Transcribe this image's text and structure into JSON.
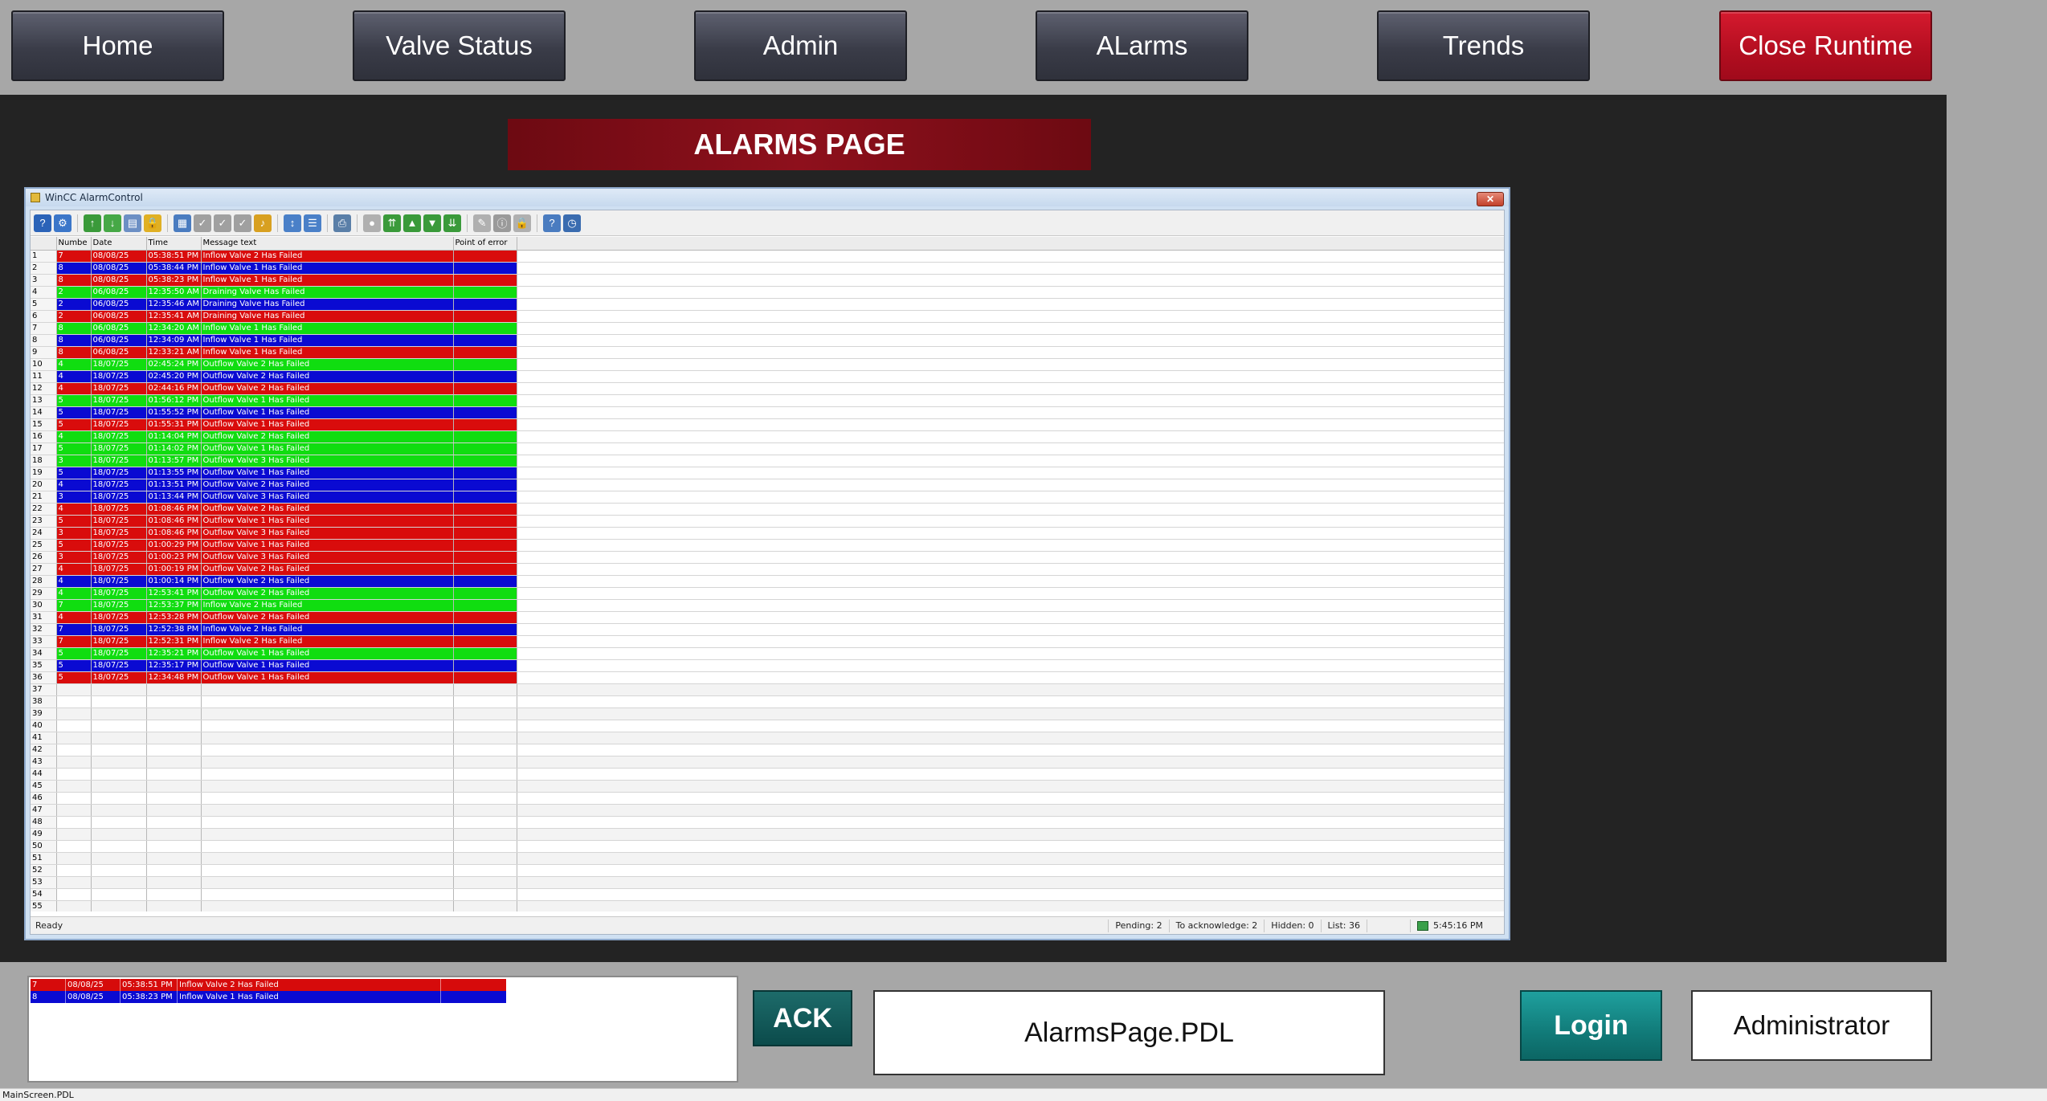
{
  "nav": {
    "home": "Home",
    "valve_status": "Valve Status",
    "admin": "Admin",
    "alarms": "ALarms",
    "trends": "Trends",
    "close_runtime": "Close Runtime"
  },
  "page_title": "ALARMS PAGE",
  "alarm_control": {
    "window_title": "WinCC AlarmControl",
    "close_glyph": "✕",
    "columns": [
      "Numbe",
      "Date",
      "Time",
      "Message text",
      "Point of error"
    ],
    "rows": [
      {
        "no": "1",
        "num": "7",
        "date": "08/08/25",
        "time": "05:38:51 PM",
        "msg": "Inflow Valve 2 Has Failed",
        "color": "red"
      },
      {
        "no": "2",
        "num": "8",
        "date": "08/08/25",
        "time": "05:38:44 PM",
        "msg": "Inflow Valve 1 Has Failed",
        "color": "blue"
      },
      {
        "no": "3",
        "num": "8",
        "date": "08/08/25",
        "time": "05:38:23 PM",
        "msg": "Inflow Valve 1 Has Failed",
        "color": "red"
      },
      {
        "no": "4",
        "num": "2",
        "date": "06/08/25",
        "time": "12:35:50 AM",
        "msg": "Draining Valve Has Failed",
        "color": "green"
      },
      {
        "no": "5",
        "num": "2",
        "date": "06/08/25",
        "time": "12:35:46 AM",
        "msg": "Draining Valve Has Failed",
        "color": "blue"
      },
      {
        "no": "6",
        "num": "2",
        "date": "06/08/25",
        "time": "12:35:41 AM",
        "msg": "Draining Valve Has Failed",
        "color": "red"
      },
      {
        "no": "7",
        "num": "8",
        "date": "06/08/25",
        "time": "12:34:20 AM",
        "msg": "Inflow Valve 1 Has Failed",
        "color": "green"
      },
      {
        "no": "8",
        "num": "8",
        "date": "06/08/25",
        "time": "12:34:09 AM",
        "msg": "Inflow Valve 1 Has Failed",
        "color": "blue"
      },
      {
        "no": "9",
        "num": "8",
        "date": "06/08/25",
        "time": "12:33:21 AM",
        "msg": "Inflow Valve 1 Has Failed",
        "color": "red"
      },
      {
        "no": "10",
        "num": "4",
        "date": "18/07/25",
        "time": "02:45:24 PM",
        "msg": "Outflow Valve 2 Has Failed",
        "color": "green"
      },
      {
        "no": "11",
        "num": "4",
        "date": "18/07/25",
        "time": "02:45:20 PM",
        "msg": "Outflow Valve 2 Has Failed",
        "color": "blue"
      },
      {
        "no": "12",
        "num": "4",
        "date": "18/07/25",
        "time": "02:44:16 PM",
        "msg": "Outflow Valve 2 Has Failed",
        "color": "red"
      },
      {
        "no": "13",
        "num": "5",
        "date": "18/07/25",
        "time": "01:56:12 PM",
        "msg": "Outflow Valve 1 Has Failed",
        "color": "green"
      },
      {
        "no": "14",
        "num": "5",
        "date": "18/07/25",
        "time": "01:55:52 PM",
        "msg": "Outflow Valve 1 Has Failed",
        "color": "blue"
      },
      {
        "no": "15",
        "num": "5",
        "date": "18/07/25",
        "time": "01:55:31 PM",
        "msg": "Outflow Valve 1 Has Failed",
        "color": "red"
      },
      {
        "no": "16",
        "num": "4",
        "date": "18/07/25",
        "time": "01:14:04 PM",
        "msg": "Outflow Valve 2 Has Failed",
        "color": "green"
      },
      {
        "no": "17",
        "num": "5",
        "date": "18/07/25",
        "time": "01:14:02 PM",
        "msg": "Outflow Valve 1 Has Failed",
        "color": "green"
      },
      {
        "no": "18",
        "num": "3",
        "date": "18/07/25",
        "time": "01:13:57 PM",
        "msg": "Outflow Valve 3 Has Failed",
        "color": "green"
      },
      {
        "no": "19",
        "num": "5",
        "date": "18/07/25",
        "time": "01:13:55 PM",
        "msg": "Outflow Valve 1 Has Failed",
        "color": "blue"
      },
      {
        "no": "20",
        "num": "4",
        "date": "18/07/25",
        "time": "01:13:51 PM",
        "msg": "Outflow Valve 2 Has Failed",
        "color": "blue"
      },
      {
        "no": "21",
        "num": "3",
        "date": "18/07/25",
        "time": "01:13:44 PM",
        "msg": "Outflow Valve 3 Has Failed",
        "color": "blue"
      },
      {
        "no": "22",
        "num": "4",
        "date": "18/07/25",
        "time": "01:08:46 PM",
        "msg": "Outflow Valve 2 Has Failed",
        "color": "red"
      },
      {
        "no": "23",
        "num": "5",
        "date": "18/07/25",
        "time": "01:08:46 PM",
        "msg": "Outflow Valve 1 Has Failed",
        "color": "red"
      },
      {
        "no": "24",
        "num": "3",
        "date": "18/07/25",
        "time": "01:08:46 PM",
        "msg": "Outflow Valve 3 Has Failed",
        "color": "red"
      },
      {
        "no": "25",
        "num": "5",
        "date": "18/07/25",
        "time": "01:00:29 PM",
        "msg": "Outflow Valve 1 Has Failed",
        "color": "red"
      },
      {
        "no": "26",
        "num": "3",
        "date": "18/07/25",
        "time": "01:00:23 PM",
        "msg": "Outflow Valve 3 Has Failed",
        "color": "red"
      },
      {
        "no": "27",
        "num": "4",
        "date": "18/07/25",
        "time": "01:00:19 PM",
        "msg": "Outflow Valve 2 Has Failed",
        "color": "red"
      },
      {
        "no": "28",
        "num": "4",
        "date": "18/07/25",
        "time": "01:00:14 PM",
        "msg": "Outflow Valve 2 Has Failed",
        "color": "blue"
      },
      {
        "no": "29",
        "num": "4",
        "date": "18/07/25",
        "time": "12:53:41 PM",
        "msg": "Outflow Valve 2 Has Failed",
        "color": "green"
      },
      {
        "no": "30",
        "num": "7",
        "date": "18/07/25",
        "time": "12:53:37 PM",
        "msg": "Inflow Valve 2 Has Failed",
        "color": "green"
      },
      {
        "no": "31",
        "num": "4",
        "date": "18/07/25",
        "time": "12:53:28 PM",
        "msg": "Outflow Valve 2 Has Failed",
        "color": "red"
      },
      {
        "no": "32",
        "num": "7",
        "date": "18/07/25",
        "time": "12:52:38 PM",
        "msg": "Inflow Valve 2 Has Failed",
        "color": "blue"
      },
      {
        "no": "33",
        "num": "7",
        "date": "18/07/25",
        "time": "12:52:31 PM",
        "msg": "Inflow Valve 2 Has Failed",
        "color": "red"
      },
      {
        "no": "34",
        "num": "5",
        "date": "18/07/25",
        "time": "12:35:21 PM",
        "msg": "Outflow Valve 1 Has Failed",
        "color": "green"
      },
      {
        "no": "35",
        "num": "5",
        "date": "18/07/25",
        "time": "12:35:17 PM",
        "msg": "Outflow Valve 1 Has Failed",
        "color": "blue"
      },
      {
        "no": "36",
        "num": "5",
        "date": "18/07/25",
        "time": "12:34:48 PM",
        "msg": "Outflow Valve 1 Has Failed",
        "color": "red"
      }
    ],
    "empty_row_numbers": [
      "37",
      "38",
      "39",
      "40",
      "41",
      "42",
      "43",
      "44",
      "45",
      "46",
      "47",
      "48",
      "49",
      "50",
      "51",
      "52",
      "53",
      "54",
      "55"
    ],
    "status": {
      "ready": "Ready",
      "pending": "Pending: 2",
      "to_acknowledge": "To acknowledge: 2",
      "hidden": "Hidden: 0",
      "list": "List: 36",
      "clock": "5:45:16 PM"
    },
    "toolbar_icons": [
      "help-icon",
      "config-icon",
      "first-page-icon",
      "prev-page-icon",
      "report-icon",
      "lock-icon",
      "chart-icon",
      "ack-single-icon",
      "ack-group-icon",
      "ack-emergency-icon",
      "hornsignal-icon",
      "sort-icon",
      "select-icon",
      "print-icon",
      "loop-icon",
      "top-icon",
      "prev-alarm-icon",
      "next-alarm-icon",
      "bottom-icon",
      "comment-icon",
      "info-icon",
      "lock-alarm-icon",
      "history-icon",
      "time-icon"
    ]
  },
  "mini_alarm": {
    "rows": [
      {
        "num": "7",
        "date": "08/08/25",
        "time": "05:38:51 PM",
        "msg": "Inflow Valve 2 Has Failed"
      },
      {
        "num": "8",
        "date": "08/08/25",
        "time": "05:38:23 PM",
        "msg": "Inflow Valve 1 Has Failed"
      }
    ]
  },
  "buttons": {
    "ack": "ACK",
    "login": "Login"
  },
  "pdl_name": "AlarmsPage.PDL",
  "current_user": "Administrator",
  "footer_status": "MainScreen.PDL",
  "colors": {
    "red": "#d90c0c",
    "blue": "#0a0ad2",
    "green": "#10dd10",
    "nav_dark": "#3a3c48",
    "close_red": "#b30e20",
    "teal": "#117b79"
  }
}
